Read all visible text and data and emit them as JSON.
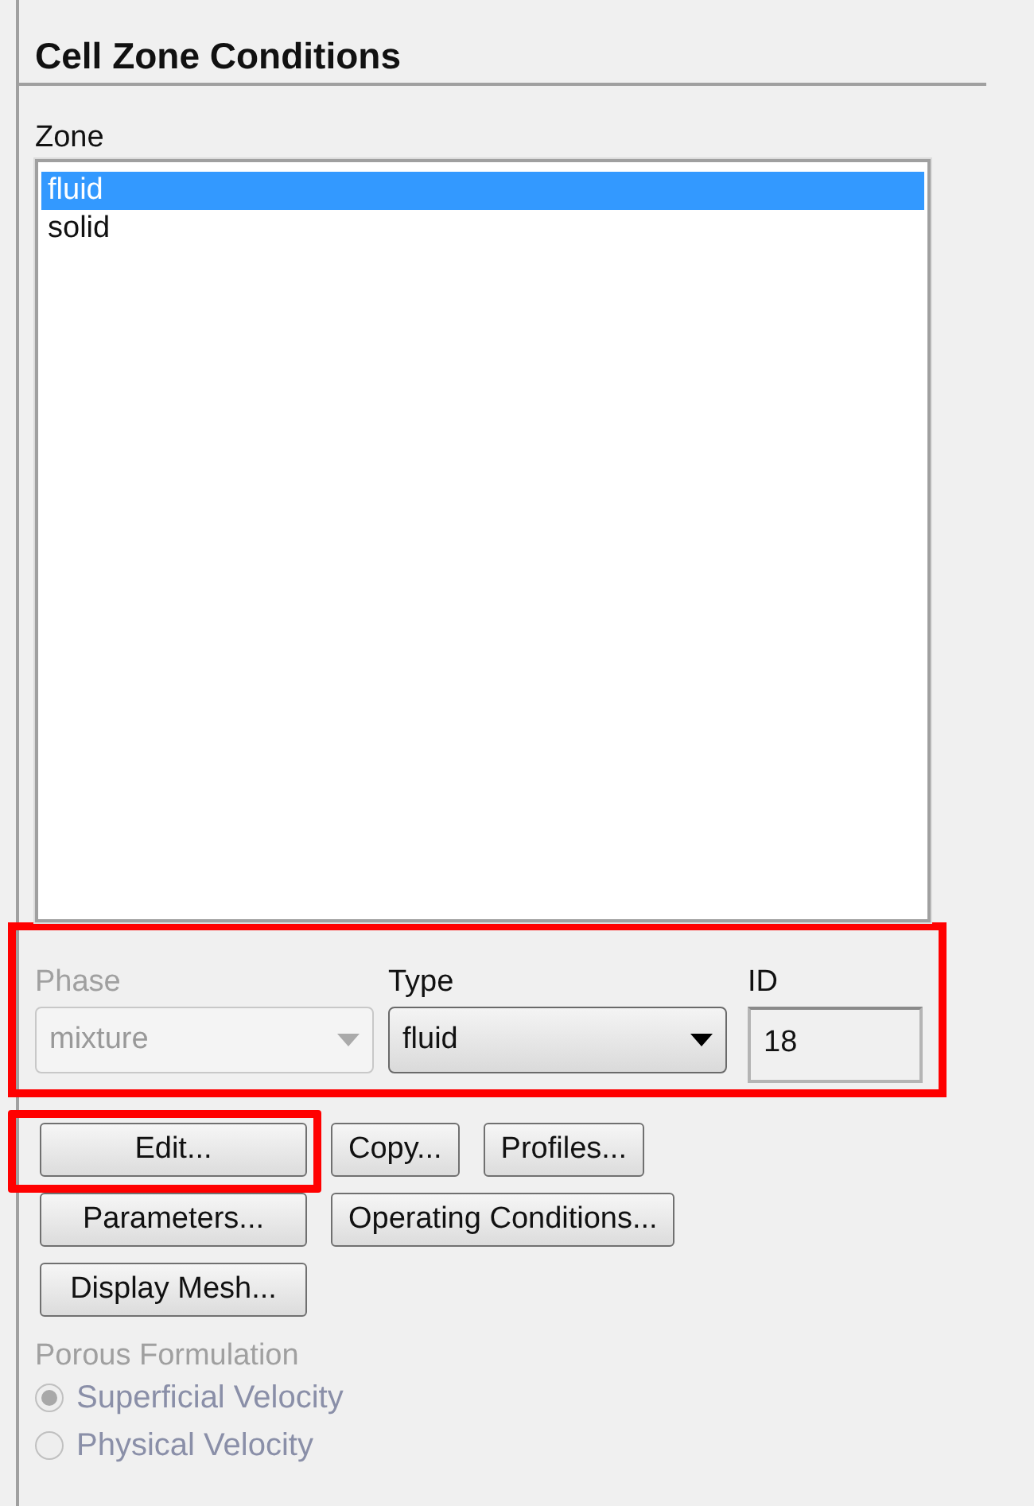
{
  "panel": {
    "title": "Cell Zone Conditions"
  },
  "zone": {
    "label": "Zone",
    "items": [
      {
        "label": "fluid",
        "selected": true
      },
      {
        "label": "solid",
        "selected": false
      }
    ]
  },
  "properties": {
    "highlighted": true,
    "phase": {
      "label": "Phase",
      "value": "mixture",
      "disabled": true
    },
    "type": {
      "label": "Type",
      "value": "fluid",
      "disabled": false
    },
    "id": {
      "label": "ID",
      "value": "18"
    }
  },
  "button_rows": [
    {
      "buttons": [
        {
          "label": "Edit...",
          "highlighted": true
        },
        {
          "label": "Copy...",
          "highlighted": false
        },
        {
          "label": "Profiles...",
          "highlighted": false
        }
      ]
    },
    {
      "buttons": [
        {
          "label": "Parameters...",
          "highlighted": false
        },
        {
          "label": "Operating Conditions...",
          "highlighted": false
        }
      ]
    },
    {
      "buttons": [
        {
          "label": "Display Mesh...",
          "highlighted": false
        }
      ]
    }
  ],
  "porous_formulation": {
    "label": "Porous Formulation",
    "disabled": true,
    "options": [
      {
        "label": "Superficial Velocity",
        "selected": true
      },
      {
        "label": "Physical Velocity",
        "selected": false
      }
    ]
  }
}
